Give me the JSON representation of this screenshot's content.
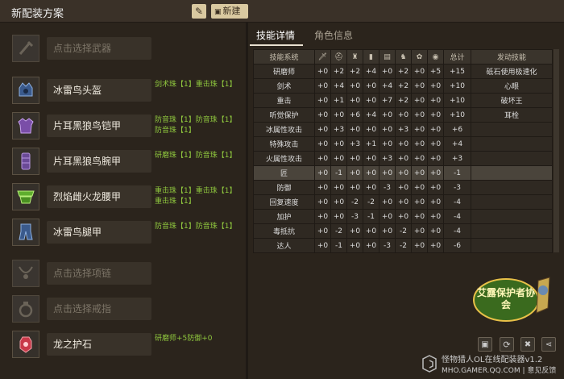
{
  "header": {
    "title": "新配装方案",
    "new_label": "新建"
  },
  "equipment": [
    {
      "name": "点击选择武器",
      "placeholder": true,
      "jewels": []
    },
    {
      "name": "冰雷鸟头盔",
      "placeholder": false,
      "jewels": [
        "剑术珠【1】重击珠【1】"
      ]
    },
    {
      "name": "片耳黑狼鸟铠甲",
      "placeholder": false,
      "jewels": [
        "防音珠【1】防音珠【1】",
        "防音珠【1】"
      ]
    },
    {
      "name": "片耳黑狼鸟腕甲",
      "placeholder": false,
      "jewels": [
        "研磨珠【1】防音珠【1】"
      ]
    },
    {
      "name": "烈焰雌火龙腰甲",
      "placeholder": false,
      "jewels": [
        "重击珠【1】重击珠【1】",
        "重击珠【1】"
      ]
    },
    {
      "name": "冰雷鸟腿甲",
      "placeholder": false,
      "jewels": [
        "防音珠【1】防音珠【1】"
      ]
    },
    {
      "name": "点击选择项链",
      "placeholder": true,
      "jewels": []
    },
    {
      "name": "点击选择戒指",
      "placeholder": true,
      "jewels": []
    },
    {
      "name": "龙之护石",
      "placeholder": false,
      "jewels": [
        "研磨师+5防御+0"
      ]
    }
  ],
  "tabs": [
    {
      "label": "技能详情",
      "active": true
    },
    {
      "label": "角色信息",
      "active": false
    }
  ],
  "skills_table": {
    "header": [
      "技能系统",
      "总计",
      "发动技能"
    ],
    "rows": [
      {
        "name": "研磨师",
        "values": [
          "+0",
          "+2",
          "+2",
          "+4",
          "+0",
          "+2",
          "+0",
          "+5"
        ],
        "total": "+15",
        "skill": "砥石使用极速化"
      },
      {
        "name": "剑术",
        "values": [
          "+0",
          "+4",
          "+0",
          "+0",
          "+4",
          "+2",
          "+0",
          "+0"
        ],
        "total": "+10",
        "skill": "心眼"
      },
      {
        "name": "重击",
        "values": [
          "+0",
          "+1",
          "+0",
          "+0",
          "+7",
          "+2",
          "+0",
          "+0"
        ],
        "total": "+10",
        "skill": "破坏王"
      },
      {
        "name": "听觉保护",
        "values": [
          "+0",
          "+0",
          "+6",
          "+4",
          "+0",
          "+0",
          "+0",
          "+0"
        ],
        "total": "+10",
        "skill": "耳栓"
      },
      {
        "name": "冰属性攻击",
        "values": [
          "+0",
          "+3",
          "+0",
          "+0",
          "+0",
          "+3",
          "+0",
          "+0"
        ],
        "total": "+6",
        "skill": ""
      },
      {
        "name": "特殊攻击",
        "values": [
          "+0",
          "+0",
          "+3",
          "+1",
          "+0",
          "+0",
          "+0",
          "+0"
        ],
        "total": "+4",
        "skill": ""
      },
      {
        "name": "火属性攻击",
        "values": [
          "+0",
          "+0",
          "+0",
          "+0",
          "+3",
          "+0",
          "+0",
          "+0"
        ],
        "total": "+3",
        "skill": ""
      },
      {
        "name": "匠",
        "values": [
          "+0",
          "-1",
          "+0",
          "+0",
          "+0",
          "+0",
          "+0",
          "+0"
        ],
        "total": "-1",
        "skill": "",
        "highlight": true
      },
      {
        "name": "防御",
        "values": [
          "+0",
          "+0",
          "+0",
          "+0",
          "-3",
          "+0",
          "+0",
          "+0"
        ],
        "total": "-3",
        "skill": ""
      },
      {
        "name": "回复速度",
        "values": [
          "+0",
          "+0",
          "-2",
          "-2",
          "+0",
          "+0",
          "+0",
          "+0"
        ],
        "total": "-4",
        "skill": ""
      },
      {
        "name": "加护",
        "values": [
          "+0",
          "+0",
          "-3",
          "-1",
          "+0",
          "+0",
          "+0",
          "+0"
        ],
        "total": "-4",
        "skill": ""
      },
      {
        "name": "毒抵抗",
        "values": [
          "+0",
          "-2",
          "+0",
          "+0",
          "+0",
          "-2",
          "+0",
          "+0"
        ],
        "total": "-4",
        "skill": ""
      },
      {
        "name": "达人",
        "values": [
          "+0",
          "-1",
          "+0",
          "+0",
          "-3",
          "-2",
          "+0",
          "+0"
        ],
        "total": "-6",
        "skill": ""
      }
    ]
  },
  "column_icons": [
    "weapon-icon",
    "helmet-icon",
    "chest-icon",
    "arm-icon",
    "waist-icon",
    "legs-icon",
    "talisman-icon",
    "necklace-icon"
  ],
  "footer": {
    "line1": "怪物猎人OL在线配装器v1.2",
    "line2": "MHO.GAMER.QQ.COM | 意见反馈"
  },
  "mascot_text": "艾露保护者协会",
  "colors": {
    "background": "#2b241c",
    "jewel_text": "#8fc73e",
    "button": "#d9c9a0"
  }
}
